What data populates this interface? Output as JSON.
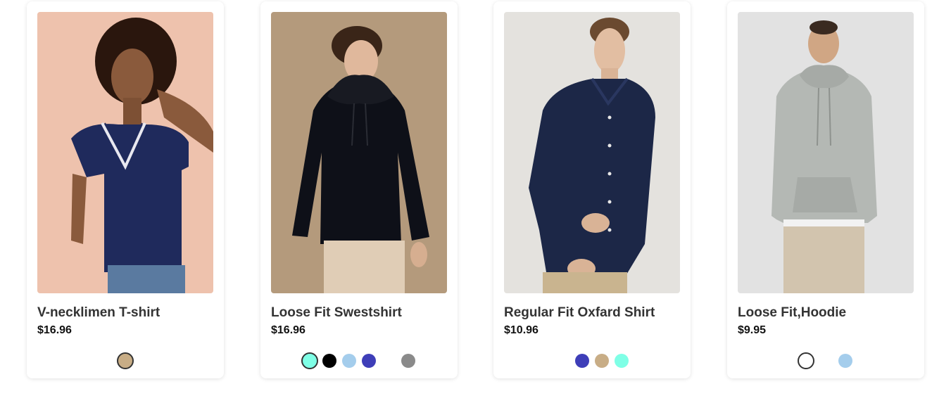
{
  "products": [
    {
      "name": "V-necklimen T-shirt",
      "price": "$16.96",
      "swatches": [
        {
          "color": "#c8ad86",
          "selected": true
        }
      ]
    },
    {
      "name": "Loose Fit Swestshirt",
      "price": "$16.96",
      "swatches": [
        {
          "color": "#7fffe6",
          "selected": true
        },
        {
          "color": "#000000",
          "selected": false
        },
        {
          "color": "#a4cdec",
          "selected": false
        },
        {
          "color": "#3e3eb8",
          "selected": false
        },
        {
          "color": "#ffffff",
          "selected": false
        },
        {
          "color": "#8a8a8a",
          "selected": false
        }
      ]
    },
    {
      "name": "Regular Fit Oxfard Shirt",
      "price": "$10.96",
      "swatches": [
        {
          "color": "#3e3eb8",
          "selected": false
        },
        {
          "color": "#c8ad86",
          "selected": false
        },
        {
          "color": "#7fffe6",
          "selected": false
        }
      ]
    },
    {
      "name": "Loose Fit,Hoodie",
      "price": "$9.95",
      "swatches": [
        {
          "color": "#ffffff",
          "selected": true
        },
        {
          "color": "#ffffff",
          "selected": false
        },
        {
          "color": "#a4cdec",
          "selected": false
        }
      ]
    }
  ]
}
